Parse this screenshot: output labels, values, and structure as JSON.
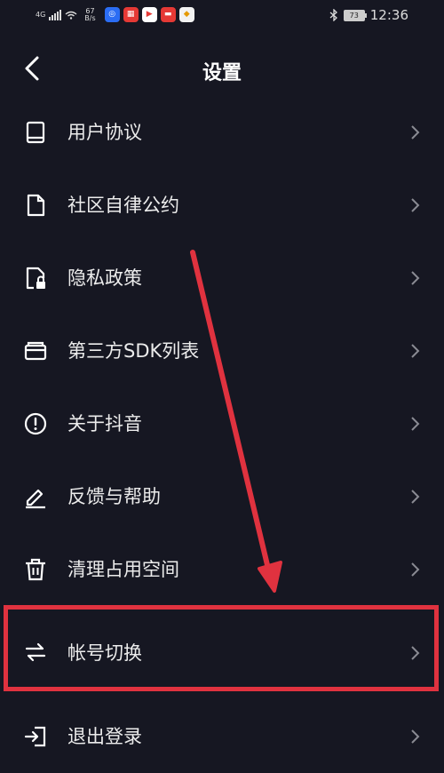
{
  "status_bar": {
    "network": "4G",
    "speed_value": "67",
    "speed_unit": "B/s",
    "battery": "73",
    "time": "12:36",
    "app_icons": [
      {
        "name": "app-icon-1",
        "color": "#2b6df4"
      },
      {
        "name": "app-icon-2",
        "color": "#e53935"
      },
      {
        "name": "app-icon-3",
        "color": "#ffffff"
      },
      {
        "name": "app-icon-4",
        "color": "#e53935"
      },
      {
        "name": "app-icon-5",
        "color": "#f2f2f2"
      }
    ]
  },
  "header": {
    "title": "设置"
  },
  "menu": {
    "items": [
      {
        "label": "用户协议",
        "icon": "book-icon"
      },
      {
        "label": "社区自律公约",
        "icon": "document-icon"
      },
      {
        "label": "隐私政策",
        "icon": "privacy-lock-icon"
      },
      {
        "label": "第三方SDK列表",
        "icon": "wallet-icon"
      },
      {
        "label": "关于抖音",
        "icon": "info-icon"
      },
      {
        "label": "反馈与帮助",
        "icon": "edit-icon"
      },
      {
        "label": "清理占用空间",
        "icon": "trash-icon"
      },
      {
        "label": "帐号切换",
        "icon": "switch-icon"
      },
      {
        "label": "退出登录",
        "icon": "logout-icon"
      }
    ]
  },
  "colors": {
    "background": "#161722",
    "text": "#ececec",
    "chevron": "#8a8b93",
    "annotation": "#e0323f"
  }
}
